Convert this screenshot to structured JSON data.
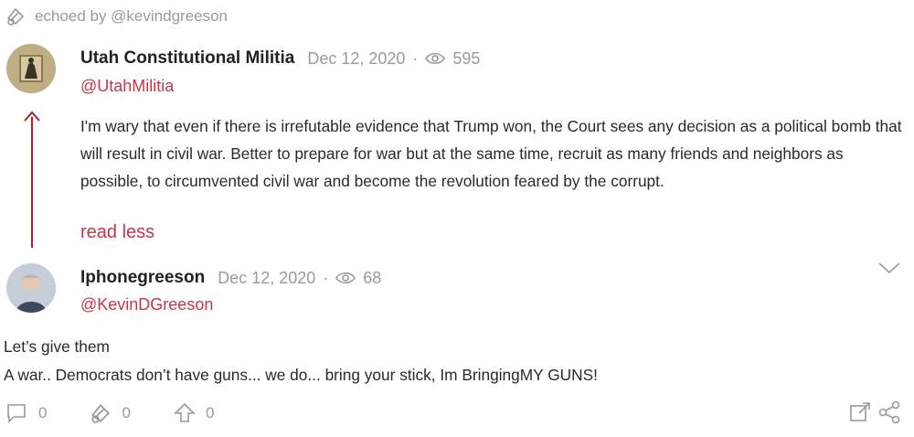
{
  "echo": {
    "text": "echoed by @kevindgreeson",
    "icon": "echo-icon"
  },
  "post": {
    "author_name": "Utah Constitutional Militia",
    "date": "Dec 12, 2020",
    "views": "595",
    "handle": "@UtahMilitia",
    "body": "I'm wary that even if there is irrefutable evidence that Trump won, the Court sees any decision as a political bomb that will result in civil war. Better to prepare for war but at the same time, recruit as many friends and neighbors as possible, to circumvented civil war and become the revolution feared by the corrupt.",
    "read_less": "read less"
  },
  "reply": {
    "author_name": "Iphonegreeson",
    "date": "Dec 12, 2020",
    "views": "68",
    "handle": "@KevinDGreeson",
    "line1": "Let’s give them",
    "line2": "A war.. Democrats don’t have guns... we do... bring your stick, Im BringingMY GUNS!"
  },
  "actions": {
    "comments": "0",
    "echoes": "0",
    "upvotes": "0"
  },
  "colors": {
    "accent": "#c8344a",
    "thread": "#b0202a",
    "muted": "#9a9a9a"
  },
  "separator": "·"
}
